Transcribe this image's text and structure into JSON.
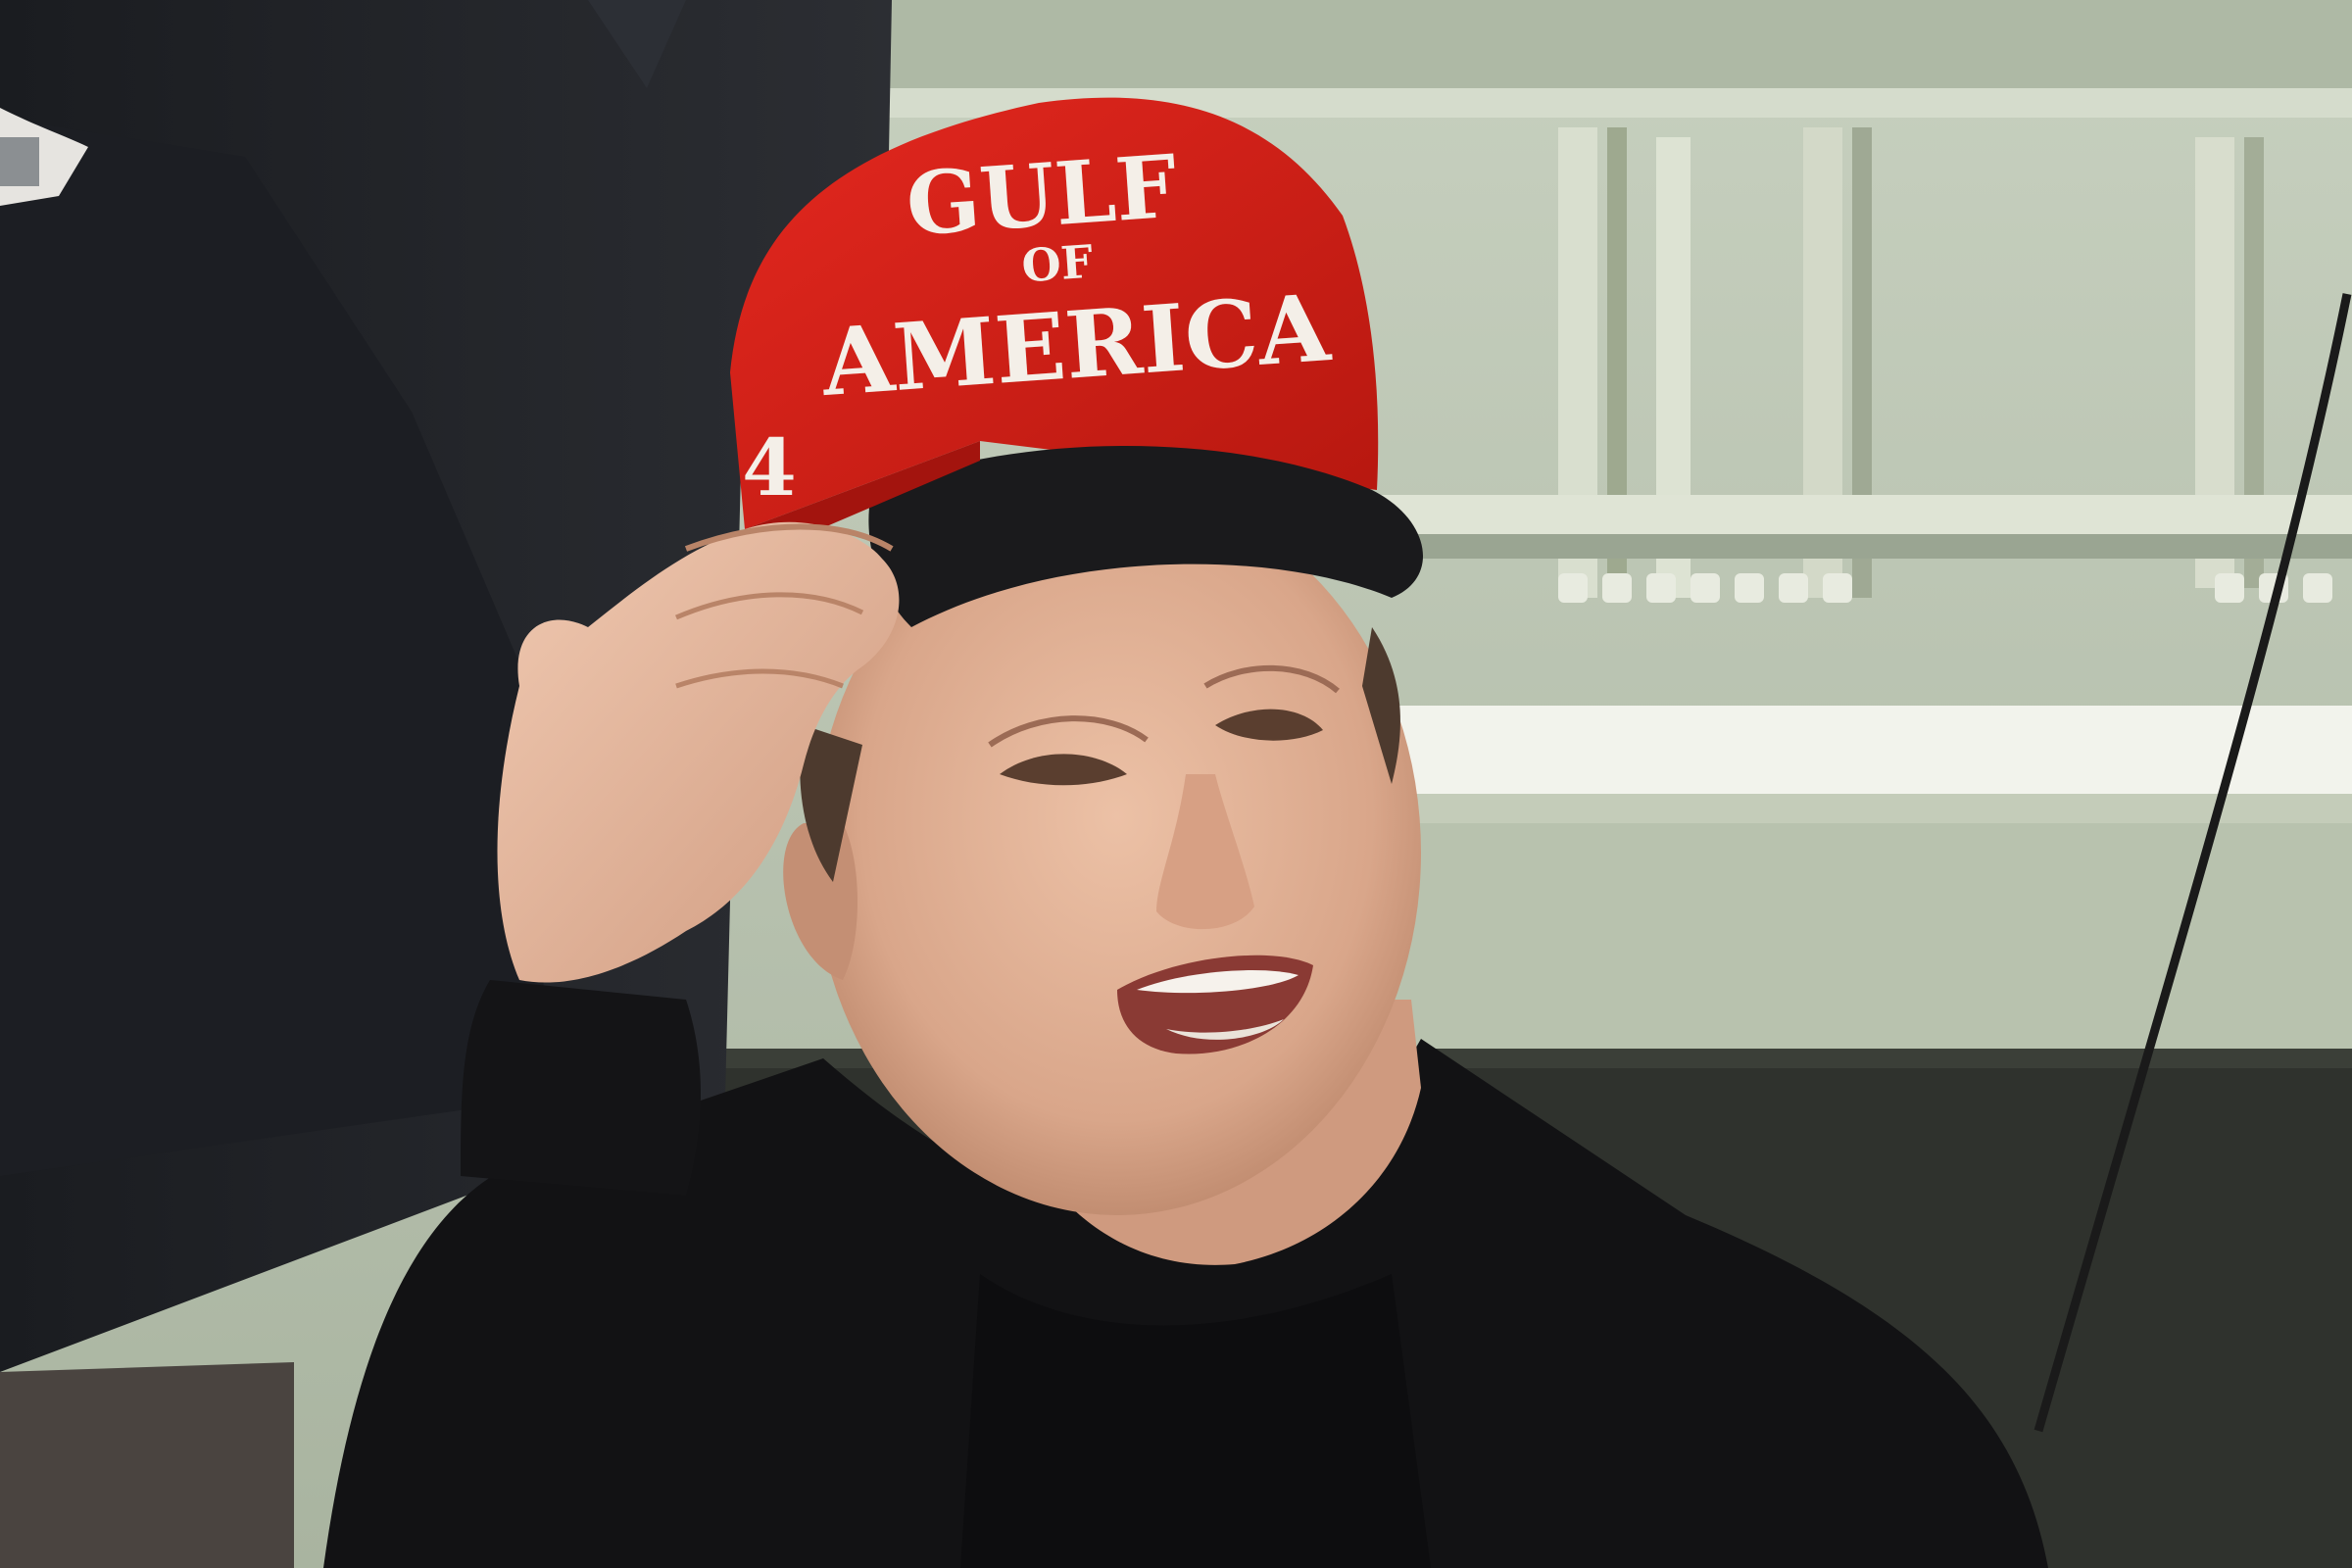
{
  "photo": {
    "cap": {
      "line1": "GULF",
      "line2": "OF",
      "line3": "AMERICA",
      "side_numeral": "4"
    },
    "colors": {
      "cap_red": "#d8211d",
      "cap_brim": "#1a1a1c",
      "wall_green": "#bcc6b4",
      "wall_shadow": "#9aa592",
      "wall_trim": "#e6e8dc",
      "jacket_black": "#121214",
      "skin": "#e2b49a",
      "background_suit": "#222428",
      "wainscot_dark": "#2f322d"
    }
  }
}
